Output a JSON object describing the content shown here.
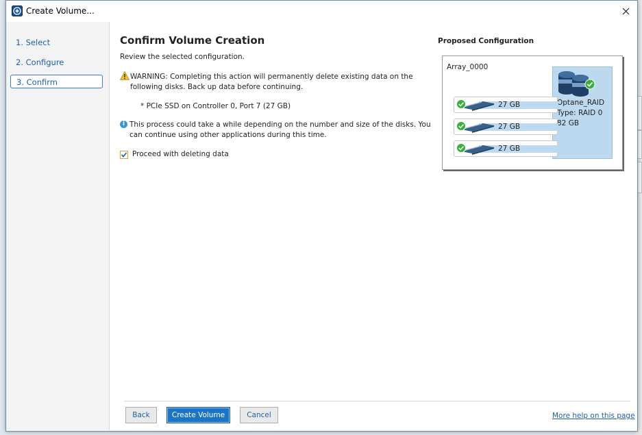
{
  "window": {
    "title": "Create Volume..."
  },
  "sidebar": {
    "steps": [
      {
        "label": "1. Select"
      },
      {
        "label": "2. Configure"
      },
      {
        "label": "3. Confirm"
      }
    ]
  },
  "main": {
    "heading": "Confirm Volume Creation",
    "subheading": "Review the selected configuration.",
    "warning": "WARNING: Completing this action will permanently delete existing data on the following disks. Back up data before continuing.",
    "disk_item": "* PCIe SSD on Controller 0, Port 7 (27 GB)",
    "info": "This process could take a while depending on the number and size of the disks. You can continue using other applications during this time.",
    "proceed_checkbox": {
      "label": "Proceed with deleting data",
      "checked": true
    }
  },
  "proposed": {
    "title": "Proposed Configuration",
    "array_name": "Array_0000",
    "volume": {
      "name": "Optane_RAID",
      "type": "Type: RAID 0",
      "size": "82 GB"
    },
    "disks": [
      {
        "size": "27 GB"
      },
      {
        "size": "27 GB"
      },
      {
        "size": "27 GB"
      }
    ]
  },
  "footer": {
    "back": "Back",
    "create": "Create Volume",
    "cancel": "Cancel",
    "help": "More help on this page"
  },
  "colors": {
    "accent": "#1b74c4",
    "link": "#1e5fa8",
    "volume_fill": "#bcd9ef",
    "check_green": "#3cae3c"
  }
}
